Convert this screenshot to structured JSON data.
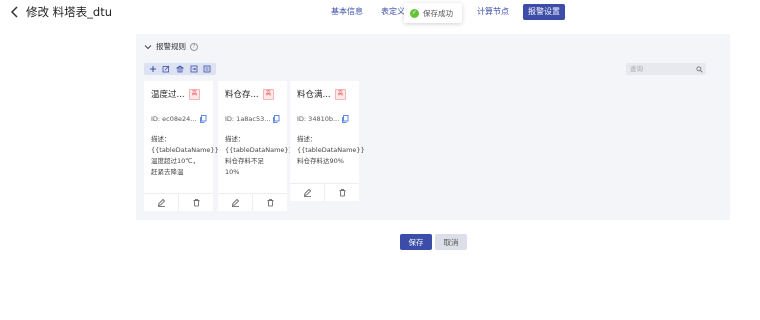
{
  "header": {
    "back_icon": "chevron-left-icon",
    "title": "修改 料塔表_dtu"
  },
  "nav": {
    "tabs": [
      {
        "label": "基本信息",
        "active": false
      },
      {
        "label": "表定义",
        "active": false
      },
      {
        "label": "计算节点",
        "active": false
      },
      {
        "label": "报警设置",
        "active": true
      }
    ],
    "active_color": "#3b4da8"
  },
  "toast": {
    "icon": "check-circle-icon",
    "text": "保存成功",
    "color": "#67c23a"
  },
  "panel": {
    "title": "报警规则",
    "help_icon": "question-circle-icon",
    "toolbar": [
      {
        "icon": "plus-icon"
      },
      {
        "icon": "edit-icon"
      },
      {
        "icon": "bank-icon"
      },
      {
        "icon": "import-icon"
      },
      {
        "icon": "export-icon"
      }
    ],
    "search": {
      "placeholder": "查询",
      "value": ""
    },
    "cards": [
      {
        "title": "温度过...",
        "level": "高",
        "id": "ID: ec08e24...",
        "desc": [
          "描述：",
          "{{tableDataName}}",
          "温度超过10℃，",
          "赶紧去降温"
        ]
      },
      {
        "title": "料仓存...",
        "level": "高",
        "id": "ID: 1a8ac53...",
        "desc": [
          "描述：",
          "{{tableDataName}}",
          "料仓存料不足",
          "10%"
        ]
      },
      {
        "title": "料仓满...",
        "level": "高",
        "id": "ID: 34810b...",
        "desc": [
          "描述：",
          "{{tableDataName}}",
          "料仓存料达90%"
        ]
      }
    ]
  },
  "footer": {
    "save_label": "保存",
    "cancel_label": "取消"
  }
}
